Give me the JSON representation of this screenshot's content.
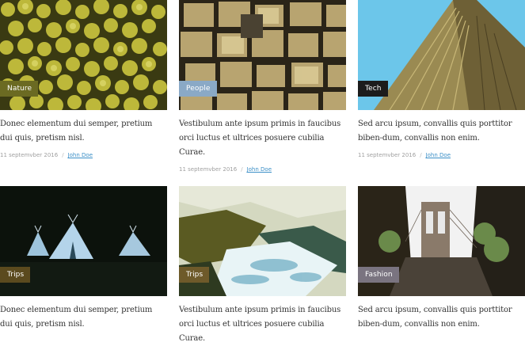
{
  "colors": {
    "badge_nature": "#6b6a22",
    "badge_people": "#8aa9c6",
    "badge_tech": "#1c1c1c",
    "badge_trips_dark": "#5b4a1e",
    "badge_trips": "#6e5a2a",
    "badge_fashion": "#7a7480",
    "link": "#3b8fc7"
  },
  "cards": [
    {
      "category": "Nature",
      "title": "Donec elementum dui semper, pretium dui quis, pretism nisl.",
      "date": "11 septemvber 2016",
      "separator": "/",
      "author": "John Doe"
    },
    {
      "category": "People",
      "title": "Vestibulum ante ipsum primis in faucibus orci luctus et ultrices posuere cubilia Curae.",
      "date": "11 septemvber 2016",
      "separator": "/",
      "author": "John Doe"
    },
    {
      "category": "Tech",
      "title": "Sed arcu ipsum, convallis quis porttitor biben-dum, convallis non enim.",
      "date": "11 septemvber 2016",
      "separator": "/",
      "author": "John Doe"
    },
    {
      "category": "Trips",
      "title": "Donec elementum dui semper, pretium dui quis, pretism nisl."
    },
    {
      "category": "Trips",
      "title": "Vestibulum ante ipsum primis in faucibus orci luctus et ultrices posuere cubilia Curae."
    },
    {
      "category": "Fashion",
      "title": "Sed arcu ipsum, convallis quis porttitor biben-dum, convallis non enim."
    }
  ]
}
